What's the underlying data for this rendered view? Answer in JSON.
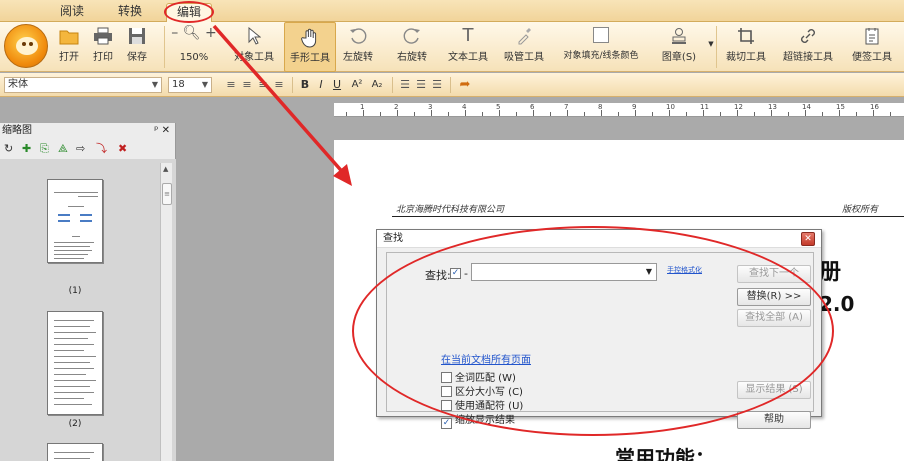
{
  "tabs": [
    {
      "label": "阅读",
      "active": false
    },
    {
      "label": "转换",
      "active": false
    },
    {
      "label": "编辑",
      "active": true
    }
  ],
  "toolbar": {
    "open": "打开",
    "print": "打印",
    "save": "保存",
    "zoom": "150%",
    "object_tool": "对象工具",
    "hand_tool": "手形工具",
    "rotate_left": "左旋转",
    "rotate_right": "右旋转",
    "text_tool": "文本工具",
    "eyedropper": "吸管工具",
    "fill_line_color": "对象填充/线条颜色",
    "stamp": "图章(S)",
    "crop": "裁切工具",
    "hyperlink": "超链接工具",
    "sticky_note": "便签工具"
  },
  "format": {
    "font_name": "宋体",
    "font_size": "18",
    "bold": "B",
    "italic": "I",
    "underline": "U",
    "superscript": "A²",
    "subscript": "A₂"
  },
  "ruler": {
    "numbers": [
      "1",
      "2",
      "3",
      "4",
      "5",
      "6",
      "7",
      "8",
      "9",
      "10",
      "11",
      "12",
      "13",
      "14",
      "15",
      "16"
    ]
  },
  "sidebar": {
    "title": "缩略图",
    "pin": "ᵖ",
    "close": "✕",
    "thumbnails": [
      {
        "label": "(1)"
      },
      {
        "label": "(2)"
      }
    ]
  },
  "document": {
    "header_left": "北京海腾时代科技有限公司",
    "header_right": "版权所有",
    "heading_fragment_1": "册",
    "heading_fragment_2": "2.0",
    "heading_fragment_3": "常用功能："
  },
  "find_dialog": {
    "title": "查找",
    "close": "✕",
    "find_label": "查找:",
    "find_checked": true,
    "find_suffix": "-",
    "find_value": "",
    "advanced_link": "手控格式化",
    "scope_link": "在当前文档所有页面",
    "options": [
      {
        "label": "全词匹配 (W)",
        "checked": false
      },
      {
        "label": "区分大小写 (C)",
        "checked": false
      },
      {
        "label": "使用通配符 (U)",
        "checked": false
      },
      {
        "label": "缩放显示结果",
        "checked": true
      }
    ],
    "buttons": {
      "find_next": "查找下一个",
      "replace": "替换(R) >>",
      "find_all": "查找全部 (A)",
      "show_results": "显示结果 (S)",
      "help": "帮助"
    }
  },
  "colors": {
    "annotation": "#e02828",
    "ribbon": "#f6e2b9"
  }
}
